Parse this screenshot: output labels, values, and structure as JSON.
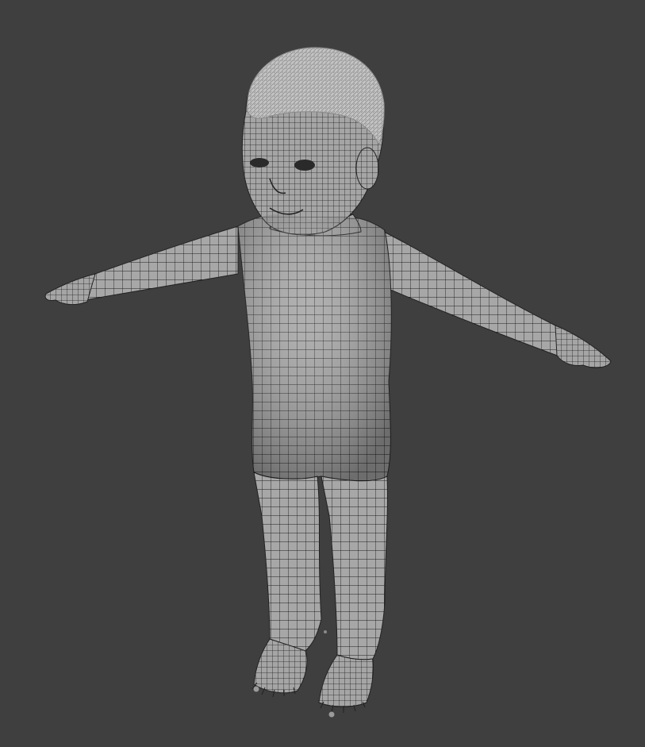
{
  "viewport": {
    "background_color": "#3f3f3f",
    "mode": "3d-viewport"
  },
  "model": {
    "shading": "solid-with-wireframe",
    "surface_color": "#a9a9a9",
    "wire_color": "#1e1e1e",
    "hair_color": "#c9c9c9",
    "pose": "t-pose"
  }
}
